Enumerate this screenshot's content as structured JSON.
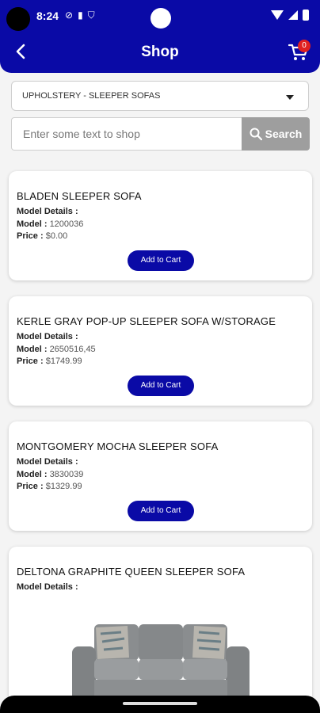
{
  "status_bar": {
    "time": "8:24"
  },
  "app_bar": {
    "title": "Shop",
    "cart_count": "0"
  },
  "filter": {
    "category": "UPHOLSTERY - SLEEPER SOFAS"
  },
  "search": {
    "placeholder": "Enter some text to shop",
    "button_label": "Search"
  },
  "labels": {
    "model_details": "Model Details :",
    "model": "Model :",
    "price": "Price :",
    "add_to_cart": "Add to Cart"
  },
  "products": [
    {
      "name": "BLADEN SLEEPER SOFA",
      "model": "1200036",
      "price": "$0.00"
    },
    {
      "name": "KERLE GRAY POP-UP SLEEPER SOFA W/STORAGE",
      "model": "2650516,45",
      "price": "$1749.99"
    },
    {
      "name": "MONTGOMERY MOCHA SLEEPER SOFA",
      "model": "3830039",
      "price": "$1329.99"
    },
    {
      "name": "DELTONA GRAPHITE QUEEN SLEEPER SOFA"
    }
  ],
  "colors": {
    "primary": "#0a0aa6",
    "search_button": "#9e9e9e",
    "badge": "#e02020"
  }
}
